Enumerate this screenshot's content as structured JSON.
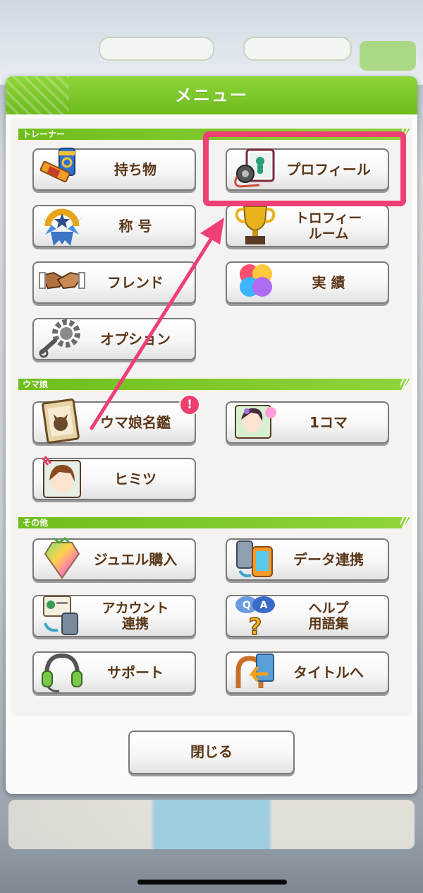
{
  "modal": {
    "title": "メニュー",
    "close_label": "閉じる"
  },
  "sections": {
    "trainer": {
      "label": "トレーナー",
      "items": [
        {
          "label": "持ち物",
          "icon": "item-bag-icon"
        },
        {
          "label": "プロフィール",
          "icon": "profile-card-icon"
        },
        {
          "label": "称 号",
          "icon": "title-medal-icon"
        },
        {
          "label_line1": "トロフィー",
          "label_line2": "ルーム",
          "icon": "trophy-icon"
        },
        {
          "label": "フレンド",
          "icon": "handshake-icon"
        },
        {
          "label": "実 績",
          "icon": "achievement-icon"
        },
        {
          "label": "オプション",
          "icon": "gear-icon"
        }
      ]
    },
    "uma": {
      "label": "ウマ娘",
      "items": [
        {
          "label": "ウマ娘名鑑",
          "icon": "encyclopedia-icon",
          "badge": "!"
        },
        {
          "label": "1コマ",
          "icon": "one-frame-icon"
        },
        {
          "label": "ヒミツ",
          "icon": "secret-icon"
        }
      ]
    },
    "other": {
      "label": "その他",
      "items": [
        {
          "label": "ジュエル購入",
          "icon": "jewel-icon"
        },
        {
          "label": "データ連携",
          "icon": "data-link-icon"
        },
        {
          "label_line1": "アカウント",
          "label_line2": "連携",
          "icon": "account-link-icon"
        },
        {
          "label_line1": "ヘルプ",
          "label_line2": "用語集",
          "icon": "help-icon"
        },
        {
          "label": "サポート",
          "icon": "headset-icon"
        },
        {
          "label": "タイトルへ",
          "icon": "return-title-icon"
        }
      ]
    }
  },
  "colors": {
    "header_green": "#7cc72a",
    "highlight_pink": "#ef3f74",
    "label_brown": "#5a3618"
  }
}
